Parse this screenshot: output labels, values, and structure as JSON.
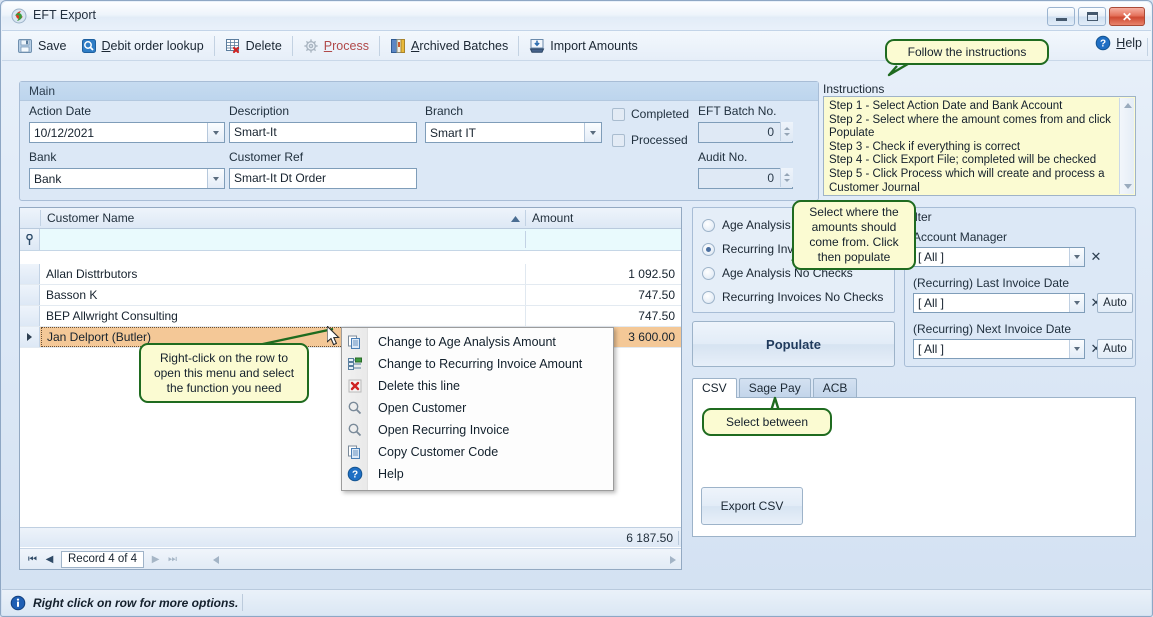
{
  "window": {
    "title": "EFT Export",
    "app_icon": "eft-app-icon",
    "minimize": "minimize-icon",
    "maximize": "maximize-icon",
    "close": "close-icon"
  },
  "toolbar": {
    "items": [
      {
        "label": "Save",
        "icon": "save-icon",
        "underline": "",
        "disabled": false
      },
      {
        "label": "Debit order lookup",
        "icon": "magnifier-icon",
        "underline": "D",
        "disabled": false
      },
      {
        "label": "Delete",
        "icon": "delete-grid-icon",
        "underline": "",
        "disabled": false
      },
      {
        "label": "Process",
        "icon": "gear-icon",
        "underline": "P",
        "disabled": true
      },
      {
        "label": "Archived Batches",
        "icon": "book-icon",
        "underline": "A",
        "disabled": false
      },
      {
        "label": "Import Amounts",
        "icon": "import-icon",
        "underline": "",
        "disabled": false
      }
    ],
    "help_label": "Help",
    "help_underline": "H",
    "help_icon": "help-circle-icon"
  },
  "main": {
    "group_title": "Main",
    "action_date_label": "Action Date",
    "action_date_value": "10/12/2021",
    "description_label": "Description",
    "description_value": "Smart-It",
    "branch_label": "Branch",
    "branch_value": "Smart IT",
    "bank_label": "Bank",
    "bank_value": "Bank",
    "customer_ref_label": "Customer Ref",
    "customer_ref_value": "Smart-It Dt Order",
    "completed_label": "Completed",
    "completed_checked": false,
    "processed_label": "Processed",
    "processed_checked": false,
    "eft_batch_label": "EFT Batch No.",
    "eft_batch_value": "0",
    "audit_label": "Audit No.",
    "audit_value": "0"
  },
  "instructions": {
    "label": "Instructions",
    "lines": [
      "Step 1 - Select Action Date and Bank Account",
      "Step 2 - Select where the amount comes from and click Populate",
      "Step 3 - Check if everything is correct",
      "Step 4 - Click Export File; completed will be checked",
      "Step 5 - Click Process which will create and process a Customer Journal"
    ]
  },
  "grid": {
    "columns": [
      "Customer Name",
      "Amount"
    ],
    "sort_column": "Customer Name",
    "sort_direction": "asc",
    "filter_row_icon": "filter-icon",
    "rows": [
      {
        "name": "Allan Disttrbutors",
        "amount": "1 092.50",
        "selected": false
      },
      {
        "name": "Basson K",
        "amount": "747.50",
        "selected": false
      },
      {
        "name": "BEP Allwright Consulting",
        "amount": "747.50",
        "selected": false
      },
      {
        "name": "Jan Delport (Butler)",
        "amount": "3 600.00",
        "selected": true
      }
    ],
    "total": "6 187.50",
    "record_status": "Record 4 of 4",
    "nav": {
      "first": "first-record-icon",
      "prev": "prev-record-icon",
      "next": "next-record-icon",
      "last": "last-record-icon"
    }
  },
  "context_menu": {
    "items": [
      {
        "label": "Change to Age Analysis Amount",
        "icon": "copy-icon"
      },
      {
        "label": "Change to Recurring Invoice Amount",
        "icon": "recurring-icon"
      },
      {
        "label": "Delete this line",
        "icon": "delete-x-icon"
      },
      {
        "label": "Open Customer",
        "icon": "magnifier-icon"
      },
      {
        "label": "Open Recurring Invoice",
        "icon": "magnifier-icon"
      },
      {
        "label": "Copy Customer Code",
        "icon": "copy-icon"
      },
      {
        "label": "Help",
        "icon": "help-circle-icon"
      }
    ]
  },
  "source_options": {
    "items": [
      {
        "label": "Age Analysis",
        "selected": false
      },
      {
        "label": "Recurring Invoices",
        "selected": true
      },
      {
        "label": "Age Analysis No Checks",
        "selected": false
      },
      {
        "label": "Recurring Invoices No Checks",
        "selected": false
      }
    ],
    "populate_label": "Populate"
  },
  "filter": {
    "group_title": "Filter",
    "account_manager_label": "Account Manager",
    "account_manager_value": "[ All ]",
    "last_invoice_label": "(Recurring) Last Invoice Date",
    "last_invoice_value": "[ All ]",
    "next_invoice_label": "(Recurring) Next Invoice Date",
    "next_invoice_value": "[ All ]",
    "clear_icon": "clear-x-icon",
    "auto_label": "Auto"
  },
  "export_tabs": {
    "tabs": [
      {
        "label": "CSV",
        "active": true
      },
      {
        "label": "Sage Pay",
        "active": false
      },
      {
        "label": "ACB",
        "active": false
      }
    ],
    "export_button": "Export CSV"
  },
  "status_bar": {
    "icon": "info-icon",
    "text": "Right click on row for more options."
  },
  "callouts": [
    {
      "id": "follow-instructions",
      "text": "Follow the instructions"
    },
    {
      "id": "select-source",
      "text": "Select where the amounts should come from. Click then populate"
    },
    {
      "id": "right-click-row",
      "text": "Right-click on the row to open this menu and select the function you need"
    },
    {
      "id": "select-between",
      "text": "Select between"
    }
  ],
  "colors": {
    "callout_border": "#1f6b1f",
    "callout_fill": "#fbfbd2",
    "selected_row": "#f4c897",
    "accent": "#4a6fa0",
    "instructions_fill": "#fbfbd2"
  }
}
